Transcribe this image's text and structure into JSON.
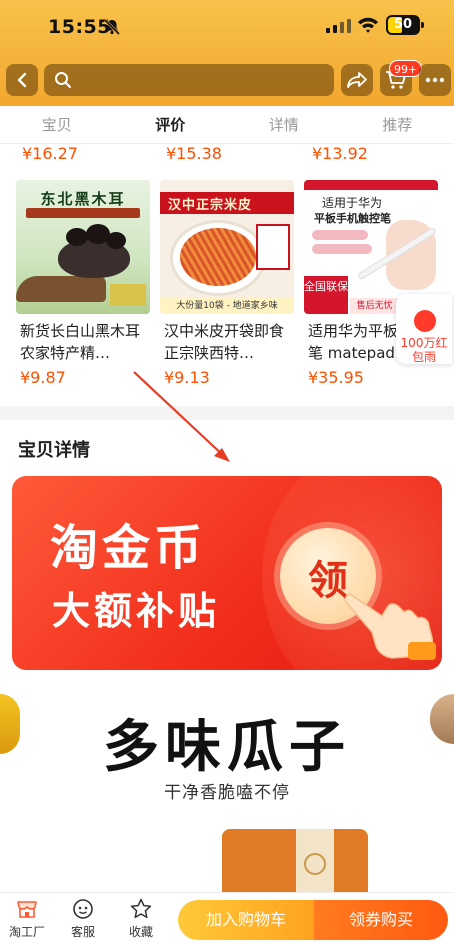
{
  "status_bar": {
    "time": "15:55",
    "battery": "50"
  },
  "header": {
    "cart_badge": "99+"
  },
  "tabs": [
    {
      "label": "宝贝",
      "active": false
    },
    {
      "label": "评价",
      "active": true
    },
    {
      "label": "详情",
      "active": false
    },
    {
      "label": "推荐",
      "active": false
    }
  ],
  "previous_row_prices": [
    "¥16.27",
    "¥15.38",
    "¥13.92"
  ],
  "products": [
    {
      "title": "新货长白山黑木耳农家特产精…",
      "price": "¥9.87",
      "image_text": "东北黑木耳"
    },
    {
      "title": "汉中米皮开袋即食正宗陕西特…",
      "price": "¥9.13",
      "image_text": "汉中正宗米皮",
      "image_footer": "大份量10袋 - 地道家乡味"
    },
    {
      "title": "适用华为平板手写笔 matepad…",
      "price": "¥35.95",
      "image_text_1": "适用于华为",
      "image_text_2": "平板手机触控笔",
      "image_badge": "全国联保",
      "image_footer": "售后无忧 极速发货"
    }
  ],
  "side_float": {
    "label": "100万红包雨"
  },
  "detail": {
    "section_title": "宝贝详情"
  },
  "banner": {
    "line1": "淘金币",
    "line2": "大额补贴",
    "coin_text": "领"
  },
  "seeds": {
    "title": "多味瓜子",
    "subtitle": "干净香脆嗑不停"
  },
  "bottom_bar": {
    "items": [
      {
        "label": "淘工厂",
        "icon": "shop-icon"
      },
      {
        "label": "客服",
        "icon": "service-icon"
      },
      {
        "label": "收藏",
        "icon": "star-icon"
      }
    ],
    "add_to_cart": "加入购物车",
    "buy_now": "领券购买"
  },
  "colors": {
    "accent": "#ff5000",
    "header": "#f2a72f",
    "banner": "#f02c1a"
  }
}
